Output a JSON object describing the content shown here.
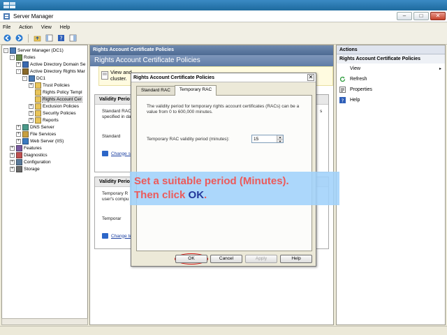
{
  "window": {
    "title": "Server Manager"
  },
  "menu": [
    "File",
    "Action",
    "View",
    "Help"
  ],
  "tree": [
    {
      "label": "Server Manager (DC1)",
      "level": 0,
      "exp": "-",
      "icon": "server-icon"
    },
    {
      "label": "Roles",
      "level": 1,
      "exp": "-",
      "icon": "roles-icon"
    },
    {
      "label": "Active Directory Domain Se",
      "level": 2,
      "exp": "+",
      "icon": "ad-icon"
    },
    {
      "label": "Active Directory Rights Mar",
      "level": 2,
      "exp": "-",
      "icon": "ad-rights-icon"
    },
    {
      "label": "DC1",
      "level": 3,
      "exp": "-",
      "icon": "server-icon"
    },
    {
      "label": "Trust Policies",
      "level": 4,
      "exp": "+",
      "icon": "folder-icon"
    },
    {
      "label": "Rights Policy Templ",
      "level": 4,
      "exp": "",
      "icon": "folder-icon"
    },
    {
      "label": "Rights Account Cer",
      "level": 4,
      "exp": "",
      "icon": "folder-icon",
      "selected": true
    },
    {
      "label": "Exclusion Policies",
      "level": 4,
      "exp": "+",
      "icon": "folder-icon"
    },
    {
      "label": "Security Policies",
      "level": 4,
      "exp": "+",
      "icon": "folder-icon"
    },
    {
      "label": "Reports",
      "level": 4,
      "exp": "+",
      "icon": "folder-icon"
    },
    {
      "label": "DNS Server",
      "level": 2,
      "exp": "+",
      "icon": "dns-icon"
    },
    {
      "label": "File Services",
      "level": 2,
      "exp": "+",
      "icon": "file-services-icon"
    },
    {
      "label": "Web Server (IIS)",
      "level": 2,
      "exp": "+",
      "icon": "web-icon"
    },
    {
      "label": "Features",
      "level": 1,
      "exp": "+",
      "icon": "features-icon"
    },
    {
      "label": "Diagnostics",
      "level": 1,
      "exp": "+",
      "icon": "diagnostics-icon"
    },
    {
      "label": "Configuration",
      "level": 1,
      "exp": "+",
      "icon": "configuration-icon"
    },
    {
      "label": "Storage",
      "level": 1,
      "exp": "+",
      "icon": "storage-icon"
    }
  ],
  "center": {
    "header": "Rights Account Certificate Policies",
    "banner": "Rights Account Certificate Policies",
    "info_line1": "View and",
    "info_line2": "cluster.",
    "section1": {
      "title": "Validity Perio",
      "text1": "Standard RAC",
      "text2": "specified in da",
      "text3": "s",
      "label": "Standard",
      "link": "Change s"
    },
    "section2": {
      "title": "Validity Perio",
      "text1": "Temporary R",
      "text2": "user's compu",
      "label": "Temporar",
      "link": "Change te"
    }
  },
  "actions": {
    "header": "Actions",
    "subheader": "Rights Account Certificate Policies",
    "items": [
      {
        "label": "View",
        "icon": "",
        "arrow": "▸"
      },
      {
        "label": "Refresh",
        "icon": "refresh-icon"
      },
      {
        "label": "Properties",
        "icon": "properties-icon"
      },
      {
        "label": "Help",
        "icon": "help-icon"
      }
    ]
  },
  "dialog": {
    "title": "Rights Account Certificate Policies",
    "close": "✕",
    "tabs": [
      "Standard RAC",
      "Temporary RAC"
    ],
    "active_tab": 1,
    "description": "The validity period for temporary rights account certificates (RACs) can be a value from 0 to 600,000 minutes.",
    "field_label": "Temporary RAC validity period (minutes):",
    "field_value": "15",
    "buttons": {
      "ok": "OK",
      "cancel": "Cancel",
      "apply": "Apply",
      "help": "Help"
    }
  },
  "callout": {
    "line1": "Set a suitable period (Minutes).",
    "line2_prefix": "Then click ",
    "line2_ok": "OK",
    "line2_suffix": "."
  },
  "colors": {
    "accent": "#1e6b9e",
    "callout_bg": "#a0d2fa",
    "callout_text": "#ec5a5a",
    "callout_ok": "#23389a",
    "highlight_ring": "#d21010"
  }
}
